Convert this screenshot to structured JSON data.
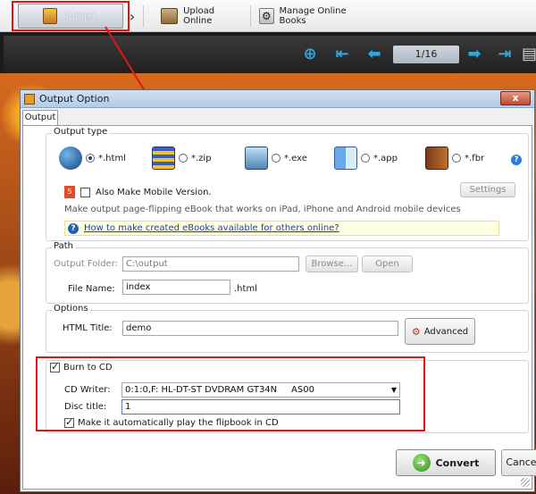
{
  "toolbar": {
    "publish_label": "Publish",
    "upload_label": "Upload Online",
    "manage_label": "Manage Online Books"
  },
  "viewer": {
    "page_indicator": "1/16"
  },
  "dialog": {
    "title": "Output Option",
    "close_glyph": "x",
    "tab_label": "Output",
    "output_type": {
      "title": "Output type",
      "formats": [
        {
          "label": "*.html",
          "icon": "globe-icon",
          "selected": true
        },
        {
          "label": "*.zip",
          "icon": "zip-archive-icon",
          "selected": false
        },
        {
          "label": "*.exe",
          "icon": "computer-icon",
          "selected": false
        },
        {
          "label": "*.app",
          "icon": "mac-finder-icon",
          "selected": false
        },
        {
          "label": "*.fbr",
          "icon": "book-icon",
          "selected": false
        }
      ],
      "mobile_checkbox_label": "Also Make Mobile Version.",
      "mobile_checked": false,
      "settings_label": "Settings",
      "mobile_note": "Make output page-flipping eBook that works on iPad, iPhone and Android mobile devices",
      "help_link": "How to make created eBooks available for others online?"
    },
    "path": {
      "title": "Path",
      "output_folder_label": "Output Folder:",
      "output_folder_value": "C:\\output",
      "browse_label": "Browse...",
      "open_label": "Open",
      "file_name_label": "File Name:",
      "file_name_value": "index",
      "file_ext": ".html"
    },
    "options": {
      "title": "Options",
      "html_title_label": "HTML Title:",
      "html_title_value": "demo",
      "advanced_label": "Advanced"
    },
    "burn": {
      "checkbox_label": "Burn to CD",
      "checked": true,
      "writer_label": "CD Writer:",
      "writer_value": "0:1:0,F: HL-DT-ST DVDRAM GT34N     AS00",
      "disc_title_label": "Disc title:",
      "disc_title_value": "1",
      "autoplay_label": "Make it automatically play the flipbook in CD",
      "autoplay_checked": true
    },
    "convert_label": "Convert",
    "cancel_label": "Cancel"
  },
  "colors": {
    "highlight": "#e31414",
    "accent_blue": "#2ea9e0"
  }
}
